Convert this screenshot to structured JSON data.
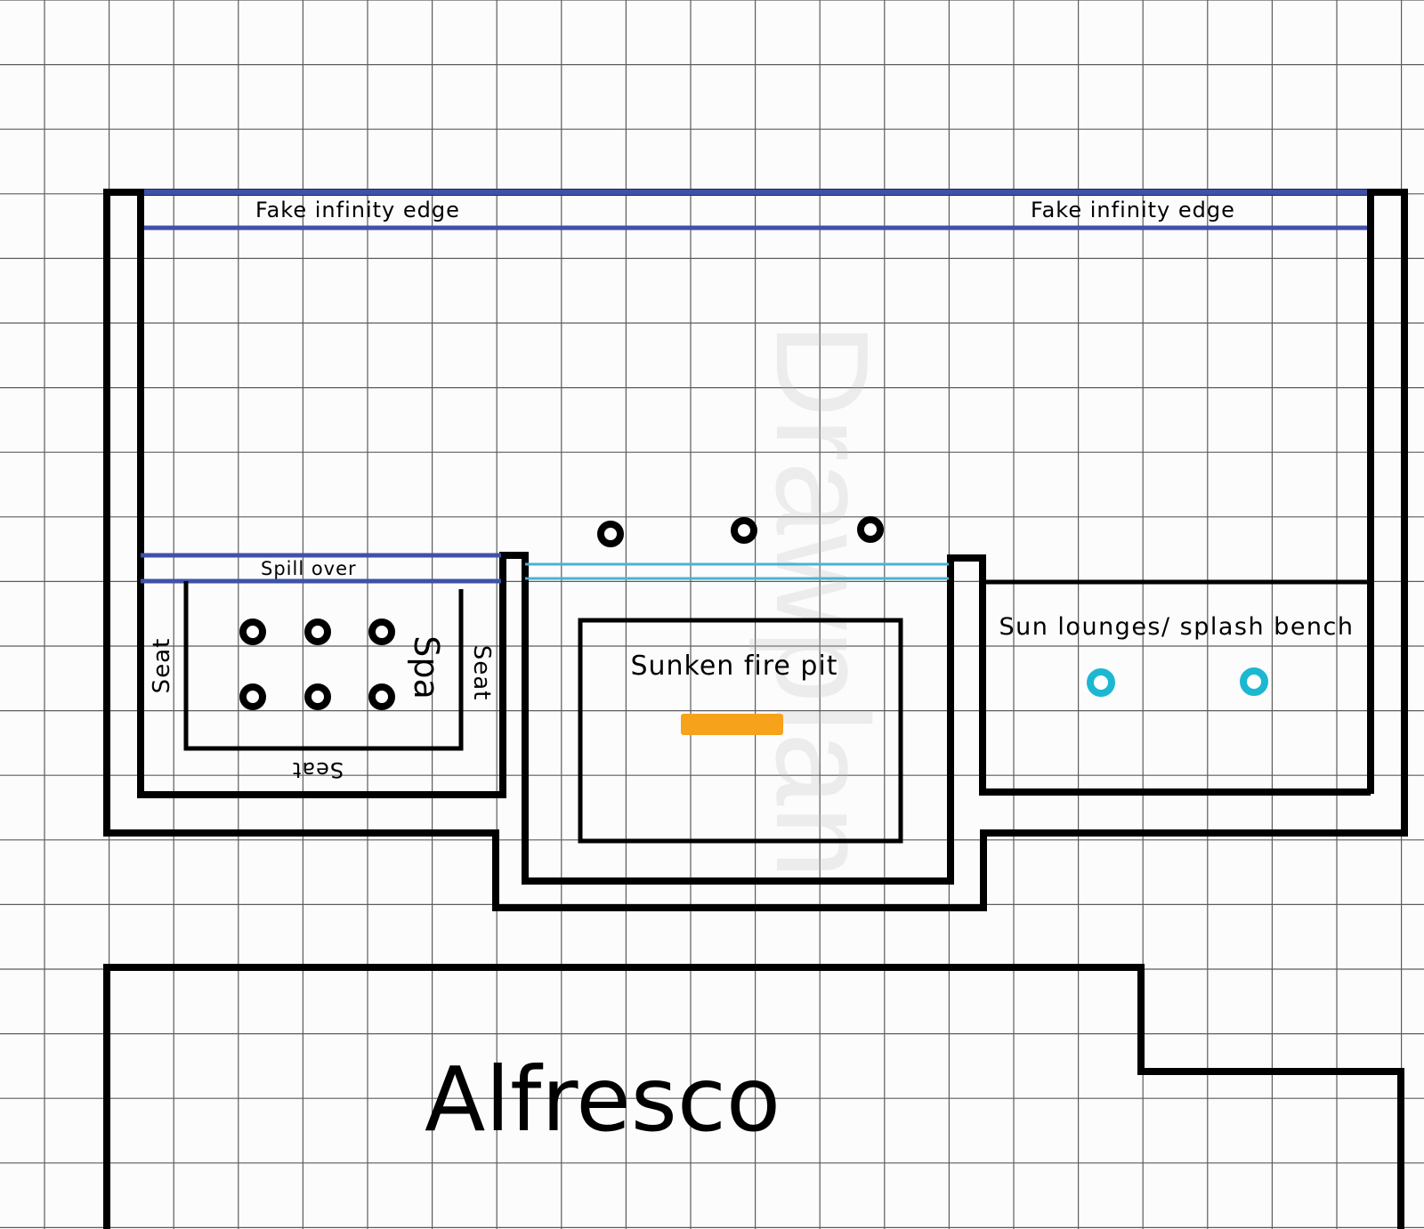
{
  "watermark": "Drawplan",
  "labels": {
    "infinity_left": "Fake infinity edge",
    "infinity_right": "Fake infinity edge",
    "spill_over": "Spill over",
    "seat_left": "Seat",
    "seat_right": "Seat",
    "seat_bottom": "Seat",
    "spa": "Spa",
    "fire_pit": "Sunken fire pit",
    "sun_lounges": "Sun lounges/ splash bench",
    "alfresco": "Alfresco"
  },
  "colors": {
    "edge_blue": "#3f51a8",
    "water_cyan": "#49b3d3",
    "jet_cyan": "#1cb8d1",
    "fire_orange": "#f7a21b",
    "grid": "#5c5c5c",
    "wall": "#000000"
  },
  "counts": {
    "spa_jets": 6,
    "pool_jets": 3,
    "bench_jets": 2
  }
}
